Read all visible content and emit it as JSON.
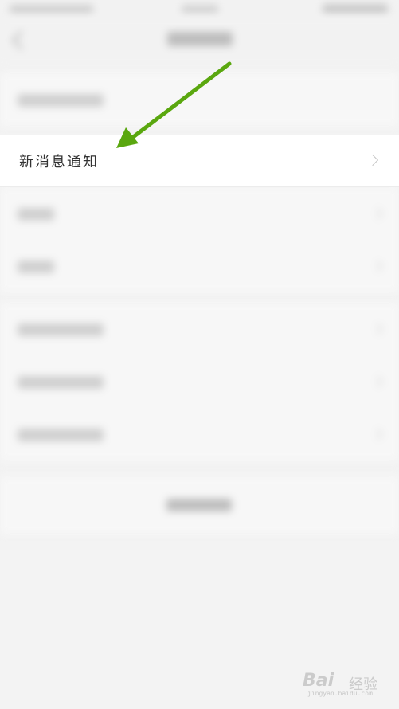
{
  "settings": {
    "highlighted_item": {
      "label": "新消息通知"
    }
  },
  "annotation": {
    "arrow_color": "#5aa70f"
  },
  "watermark": {
    "brand": "Bai",
    "brand_cn": "经验",
    "url": "jingyan.baidu.com"
  },
  "colors": {
    "page_background": "#f3f3f3",
    "row_background": "#ffffff"
  }
}
